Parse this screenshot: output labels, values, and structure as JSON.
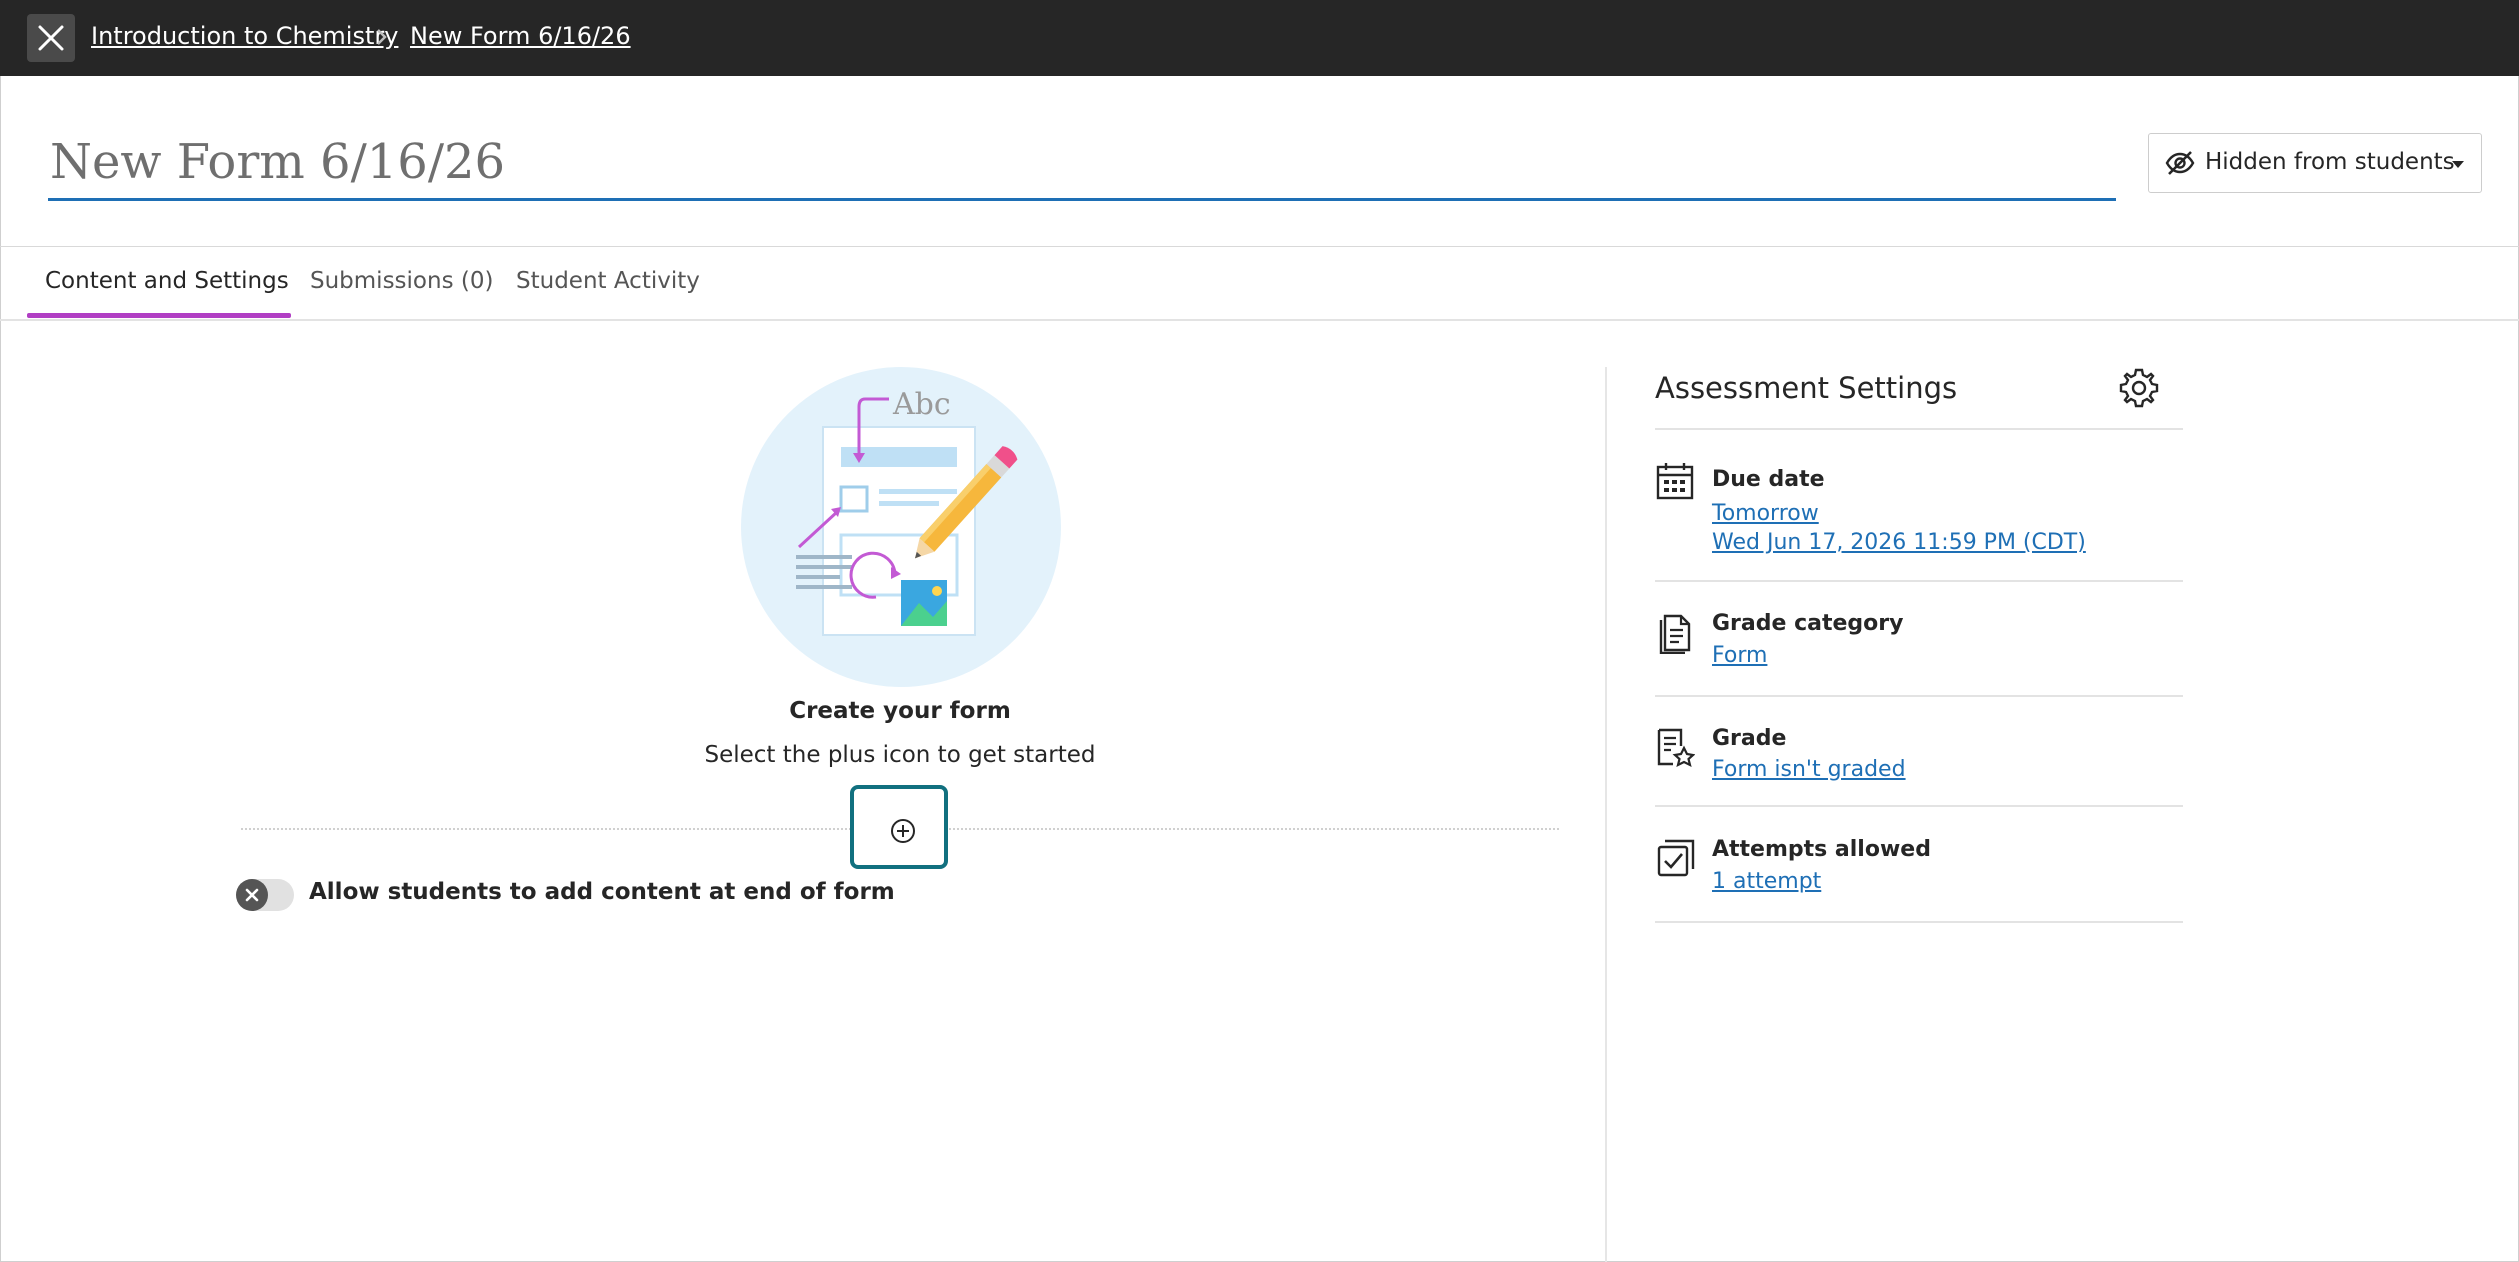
{
  "breadcrumb": {
    "course": "Introduction to Chemistry",
    "current": "New Form 6/16/26"
  },
  "form": {
    "title": "New Form 6/16/26",
    "visibility_label": "Hidden from students"
  },
  "tabs": [
    {
      "label": "Content and Settings",
      "active": true
    },
    {
      "label": "Submissions (0)",
      "active": false
    },
    {
      "label": "Student Activity",
      "active": false
    }
  ],
  "empty_state": {
    "illustration_text": "Abc",
    "title": "Create your form",
    "subtitle": "Select the plus icon to get started"
  },
  "toggle": {
    "label": "Allow students to add content at end of form",
    "enabled": false
  },
  "assessment_settings": {
    "title": "Assessment Settings",
    "due_date": {
      "label": "Due date",
      "relative": "Tomorrow",
      "value": "Wed Jun 17, 2026 11:59 PM (CDT)"
    },
    "grade_category": {
      "label": "Grade category",
      "value": "Form"
    },
    "grade": {
      "label": "Grade",
      "value": "Form isn't graded"
    },
    "attempts": {
      "label": "Attempts allowed",
      "value": "1 attempt"
    }
  },
  "colors": {
    "topbar": "#262626",
    "accent_tab": "#b13ec4",
    "link": "#1e6fb5",
    "focus_ring": "#11707f"
  }
}
